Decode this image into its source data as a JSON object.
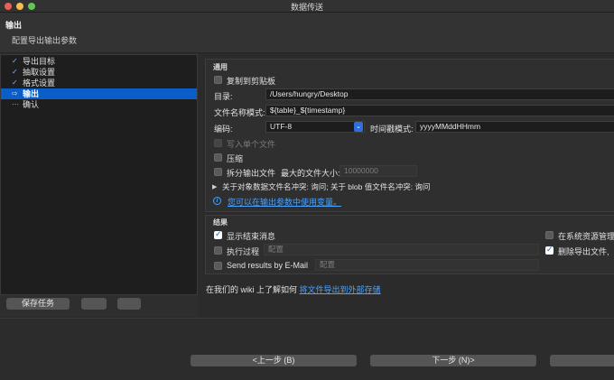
{
  "window": {
    "title": "数据传送"
  },
  "header": {
    "title": "输出",
    "subtitle": "配置导出输出参数"
  },
  "nav": {
    "items": [
      {
        "mark": "✓",
        "label": "导出目标"
      },
      {
        "mark": "✓",
        "label": "抽取设置"
      },
      {
        "mark": "✓",
        "label": "格式设置"
      },
      {
        "mark": "⇨",
        "label": "输出"
      },
      {
        "mark": "⋯",
        "label": "确认"
      }
    ],
    "active_index": 3
  },
  "left_buttons": {
    "save_task": "保存任务",
    "small1": "",
    "small2": ""
  },
  "general": {
    "title": "通用",
    "copy_to_clipboard": {
      "label": "复制到剪贴板",
      "checked": false
    },
    "directory": {
      "label": "目录:",
      "value": "/Users/hungry/Desktop"
    },
    "file_name_pattern": {
      "label": "文件名称模式:",
      "value": "${table}_${timestamp}"
    },
    "encoding": {
      "label": "编码:",
      "value": "UTF-8"
    },
    "timestamp_pattern": {
      "label": "时间戳模式:",
      "value": "yyyyMMddHHmm"
    },
    "write_single_file": {
      "label": "写入单个文件",
      "checked": false,
      "disabled": true
    },
    "compress": {
      "label": "压缩",
      "checked": false
    },
    "split_output": {
      "label": "拆分输出文件",
      "checked": false
    },
    "max_file_size": {
      "label": "最大的文件大小:",
      "value": "10000000"
    },
    "conflict_text": "关于对象数据文件名冲突: 询问; 关于 blob 值文件名冲突: 询问",
    "variables_link": "您可以在输出参数中使用变量。"
  },
  "result": {
    "title": "结果",
    "show_finish_message": {
      "label": "显示结束消息",
      "checked": true
    },
    "execute_process": {
      "label": "执行过程",
      "checked": false,
      "placeholder": "配置"
    },
    "send_email": {
      "label": "Send results by E-Mail",
      "checked": false,
      "placeholder": "配置"
    },
    "open_in_explorer": {
      "label": "在系统资源管理",
      "checked": false
    },
    "delete_exported": {
      "label": "删除导出文件,",
      "checked": true
    }
  },
  "footer": {
    "prefix": "在我们的 wiki 上了解如何",
    "link": "将文件导出到外部存储"
  },
  "bottom_buttons": {
    "prev": "<上一步 (B)",
    "next": "下一步 (N)>",
    "extra": ""
  },
  "colors": {
    "accent": "#0b5ec7",
    "link": "#4aa3ff"
  },
  "icons": {
    "info": "info-icon",
    "select_arrow": "chevron-updown-icon"
  }
}
